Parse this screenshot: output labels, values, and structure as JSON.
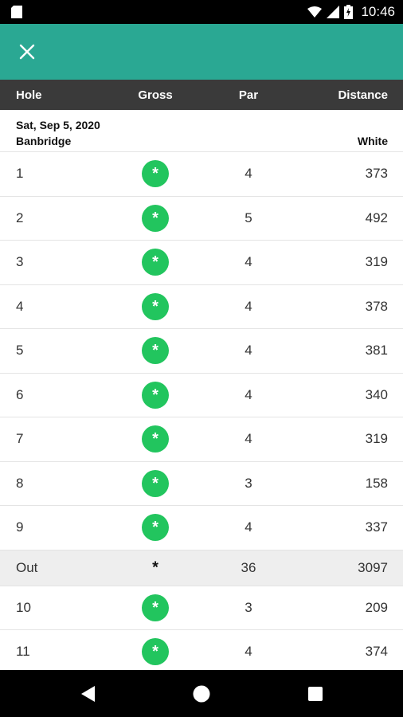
{
  "status_bar": {
    "time": "10:46",
    "icons": [
      "sim-card-icon",
      "wifi-icon",
      "signal-icon",
      "battery-charging-icon"
    ]
  },
  "app_bar": {
    "close_icon": "close-icon",
    "accent_color": "#2aa893"
  },
  "table": {
    "columns": [
      "Hole",
      "Gross",
      "Par",
      "Distance"
    ],
    "date": "Sat, Sep 5, 2020",
    "course": "Banbridge",
    "tee": "White",
    "rows": [
      {
        "hole": "1",
        "gross": "*",
        "par": "4",
        "distance": "373"
      },
      {
        "hole": "2",
        "gross": "*",
        "par": "5",
        "distance": "492"
      },
      {
        "hole": "3",
        "gross": "*",
        "par": "4",
        "distance": "319"
      },
      {
        "hole": "4",
        "gross": "*",
        "par": "4",
        "distance": "378"
      },
      {
        "hole": "5",
        "gross": "*",
        "par": "4",
        "distance": "381"
      },
      {
        "hole": "6",
        "gross": "*",
        "par": "4",
        "distance": "340"
      },
      {
        "hole": "7",
        "gross": "*",
        "par": "4",
        "distance": "319"
      },
      {
        "hole": "8",
        "gross": "*",
        "par": "3",
        "distance": "158"
      },
      {
        "hole": "9",
        "gross": "*",
        "par": "4",
        "distance": "337"
      },
      {
        "hole": "Out",
        "gross": "*",
        "par": "36",
        "distance": "3097",
        "summary": true
      },
      {
        "hole": "10",
        "gross": "*",
        "par": "3",
        "distance": "209"
      },
      {
        "hole": "11",
        "gross": "*",
        "par": "4",
        "distance": "374"
      }
    ]
  },
  "nav_bar": {
    "icons": [
      "back-icon",
      "home-icon",
      "recents-icon"
    ]
  },
  "colors": {
    "header_bg": "#3a3a3a",
    "gross_badge": "#22c55e",
    "summary_row_bg": "#eeeeee"
  }
}
